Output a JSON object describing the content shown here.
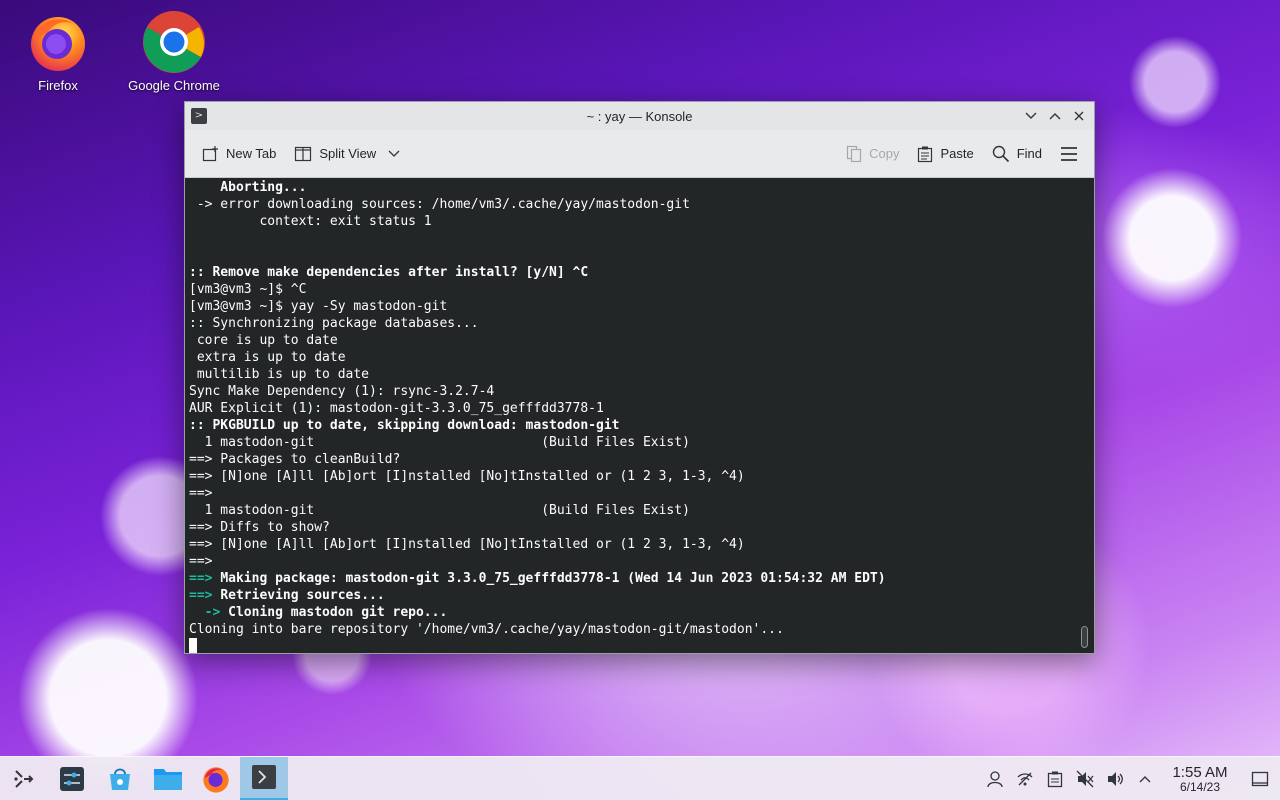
{
  "desktop": {
    "icons": [
      {
        "label": "Firefox",
        "icon": "firefox-icon"
      },
      {
        "label": "Google Chrome",
        "icon": "chrome-icon"
      }
    ]
  },
  "window": {
    "title": "~ : yay — Konsole",
    "controls": [
      "minimize",
      "maximize",
      "close"
    ]
  },
  "toolbar": {
    "new_tab": "New Tab",
    "split_view": "Split View",
    "copy": "Copy",
    "paste": "Paste",
    "find": "Find"
  },
  "terminal": {
    "lines": [
      "    Aborting...",
      " -> error downloading sources: /home/vm3/.cache/yay/mastodon-git",
      "         context: exit status 1",
      "",
      "",
      ":: Remove make dependencies after install? [y/N] ^C",
      "[vm3@vm3 ~]$ ^C",
      "[vm3@vm3 ~]$ yay -Sy mastodon-git",
      ":: Synchronizing package databases...",
      " core is up to date",
      " extra is up to date",
      " multilib is up to date",
      "Sync Make Dependency (1): rsync-3.2.7-4",
      "AUR Explicit (1): mastodon-git-3.3.0_75_gefffdd3778-1",
      ":: PKGBUILD up to date, skipping download: mastodon-git",
      "  1 mastodon-git                             (Build Files Exist)",
      "==> Packages to cleanBuild?",
      "==> [N]one [A]ll [Ab]ort [I]nstalled [No]tInstalled or (1 2 3, 1-3, ^4)",
      "==> ",
      "  1 mastodon-git                             (Build Files Exist)",
      "==> Diffs to show?",
      "==> [N]one [A]ll [Ab]ort [I]nstalled [No]tInstalled or (1 2 3, 1-3, ^4)",
      "==> ",
      "Making package: mastodon-git 3.3.0_75_gefffdd3778-1 (Wed 14 Jun 2023 01:54:32 AM EDT)",
      "Retrieving sources...",
      "Cloning mastodon git repo...",
      "Cloning into bare repository '/home/vm3/.cache/yay/mastodon-git/mastodon'..."
    ],
    "prompt_arrow": "==>",
    "sub_arrow": "  ->"
  },
  "taskbar": {
    "launchers": [
      "application-launcher-icon",
      "settings-icon",
      "discover-icon",
      "files-icon",
      "firefox-icon",
      "konsole-icon"
    ],
    "tray": [
      "user-icon",
      "network-icon",
      "clipboard-icon",
      "muted-speaker-icon",
      "volume-icon",
      "chevron-up-icon"
    ],
    "clock_time": "1:55 AM",
    "clock_date": "6/14/23"
  },
  "colors": {
    "terminal_bg": "#232627",
    "terminal_fg": "#fcfcfc",
    "highlight": "#1abc9c",
    "accent": "#3daee9"
  }
}
